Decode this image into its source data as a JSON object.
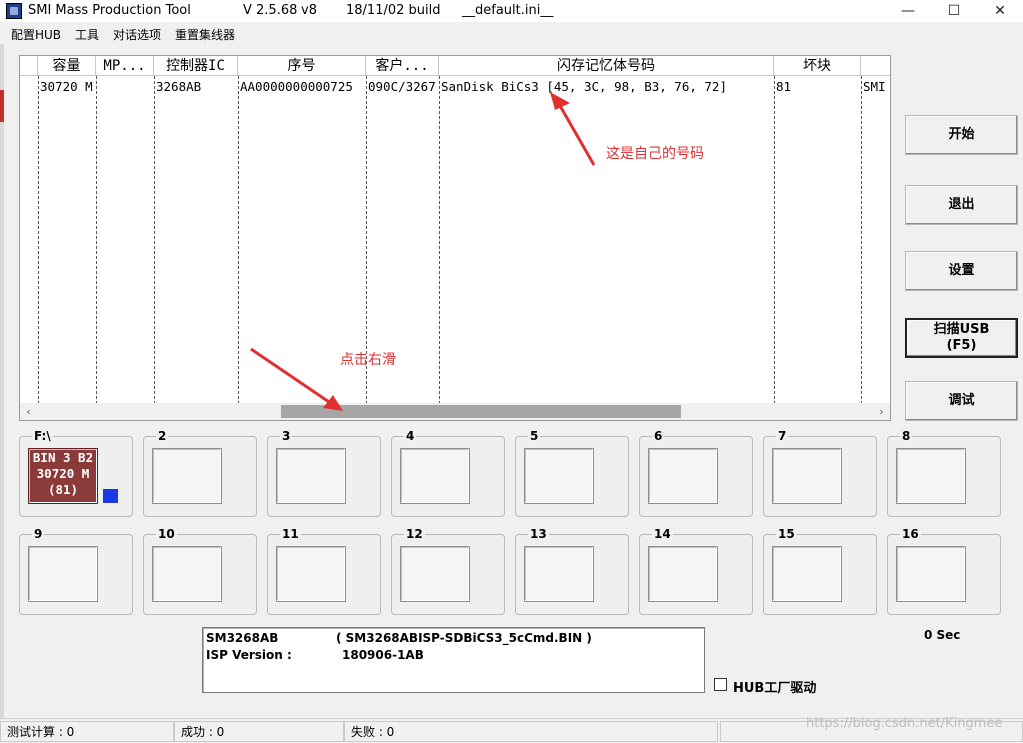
{
  "window": {
    "app_title": "SMI Mass Production Tool",
    "version": "V 2.5.68",
    "variant": "v8",
    "build": "18/11/02 build",
    "ini_file": "__default.ini__",
    "controls": {
      "minimize": "—",
      "maximize": "☐",
      "close": "✕"
    }
  },
  "menu": [
    "配置HUB",
    "工具",
    "对话选项",
    "重置集线器"
  ],
  "list": {
    "columns": [
      "",
      "容量",
      "MP...",
      "控制器IC",
      "序号",
      "客户...",
      "闪存记忆体号码",
      "坏块",
      ""
    ],
    "row": {
      "capacity": "30720 M",
      "mp": "",
      "controller": "3268AB",
      "serial": "AA0000000000725",
      "customer": "090C/3267",
      "flash_id": "SanDisk BiCs3 [45, 3C, 98, B3, 76, 72]",
      "bad_blocks": "81",
      "extra": "SMI"
    },
    "scroll_left": "‹",
    "scroll_right": "›"
  },
  "buttons": {
    "start": "开始",
    "quit": "退出",
    "settings": "设置",
    "scan_line1": "扫描USB",
    "scan_line2": "(F5)",
    "debug": "调试"
  },
  "ports": {
    "p1_label": "F:\\",
    "p1_line1": "BIN 3 B2",
    "p1_line2": "30720 M",
    "p1_line3": "(81)",
    "labels": [
      "2",
      "3",
      "4",
      "5",
      "6",
      "7",
      "8",
      "9",
      "10",
      "11",
      "12",
      "13",
      "14",
      "15",
      "16"
    ],
    "active_color": "#8b3a3a",
    "indicator_color": "#1a38e6"
  },
  "info": {
    "line1_left": "SM3268AB",
    "line1_right": "( SM3268ABISP-SDBiCS3_5cCmd.BIN )",
    "line2_left": "ISP Version :",
    "line2_right": "180906-1AB"
  },
  "timer": "0 Sec",
  "hub_factory_driver": "HUB工厂驱动",
  "status": {
    "test_count": "测试计算 : 0",
    "success": "成功 : 0",
    "fail": "失败 : 0"
  },
  "annotations": {
    "own_number": "这是自己的号码",
    "click_slide_right": "点击右滑",
    "color": "#e03030"
  },
  "watermark": "https://blog.csdn.net/Kingmee"
}
